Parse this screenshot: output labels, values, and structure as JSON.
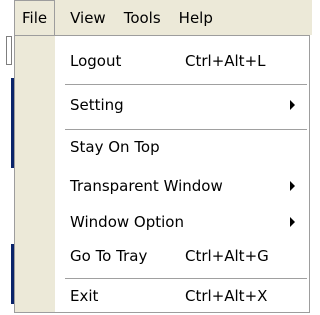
{
  "menubar": {
    "items": [
      {
        "label": "File",
        "active": true
      },
      {
        "label": "View"
      },
      {
        "label": "Tools"
      },
      {
        "label": "Help"
      }
    ]
  },
  "file_menu": {
    "items": [
      {
        "label": "Logout",
        "shortcut": "Ctrl+Alt+L",
        "submenu": false
      },
      {
        "label": "Setting",
        "shortcut": "",
        "submenu": true
      },
      {
        "label": "Stay On Top",
        "shortcut": "",
        "submenu": false
      },
      {
        "label": "Transparent Window",
        "shortcut": "",
        "submenu": true
      },
      {
        "label": "Window Option",
        "shortcut": "",
        "submenu": true
      },
      {
        "label": "Go To Tray",
        "shortcut": "Ctrl+Alt+G",
        "submenu": false
      },
      {
        "label": "Exit",
        "shortcut": "Ctrl+Alt+X",
        "submenu": false
      }
    ]
  },
  "colors": {
    "menubar_bg": "#ece9d8",
    "menu_bg": "#ffffff",
    "border": "#9d9d9d",
    "window_accent": "#0a246a"
  }
}
